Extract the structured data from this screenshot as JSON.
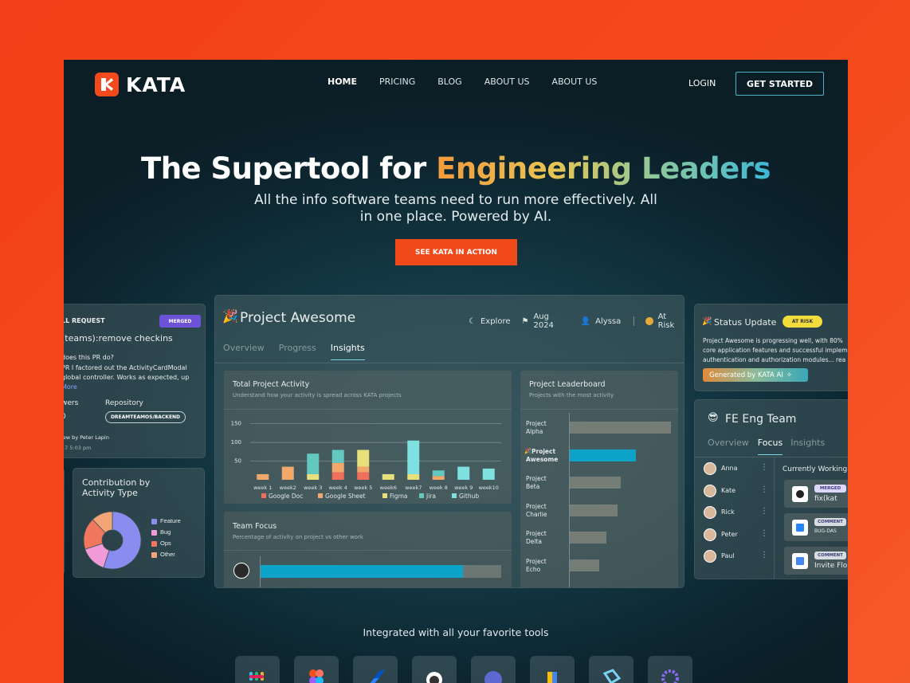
{
  "brand": {
    "name": "KATA"
  },
  "nav": {
    "links": [
      "HOME",
      "PRICING",
      "BLOG",
      "ABOUT US",
      "ABOUT US"
    ],
    "login": "LOGIN",
    "get_started": "GET STARTED"
  },
  "hero": {
    "title_prefix": "The Supertool for ",
    "title_highlight": "Engineering Leaders",
    "subtitle": "All the info software teams need to run more effectively. All in one place. Powered by AI.",
    "cta": "SEE KATA IN ACTION"
  },
  "pr_card": {
    "label": "LL REQUEST",
    "badge": "MERGED",
    "title": "(teams):remove checkins",
    "question": "does this PR do?",
    "body_line1": "PR I factored out the ActivityCardModal",
    "body_line2": "global controller. Works as expected, up",
    "more": "More",
    "reviewers_label": "wers",
    "reviewers_value": "0",
    "repo_label": "Repository",
    "repo_value": "DREAMTEAMOS/BACKEND",
    "review_by": "iew by Peter Lapin",
    "review_date": "17 5:03 pm"
  },
  "contribution": {
    "title": "Contribution by Activity Type",
    "legend": [
      "Feature",
      "Bug",
      "Ops",
      "Other"
    ],
    "colors": [
      "#8a8cf0",
      "#f09ad8",
      "#f1785d",
      "#f2a576"
    ],
    "values": [
      55,
      15,
      18,
      12
    ]
  },
  "project": {
    "emoji": "🎉",
    "title": "Project Awesome",
    "meta": {
      "explore": "Explore",
      "date": "Aug 2024",
      "owner": "Alyssa",
      "status": "At Risk"
    },
    "tabs": [
      "Overview",
      "Progress",
      "Insights"
    ],
    "active_tab": "Insights",
    "activity": {
      "title": "Total Project Activity",
      "subtitle": "Understand how your activity is spread across KATA projects"
    },
    "leaderboard": {
      "title": "Project Leaderboard",
      "subtitle": "Projects with the most activity",
      "items": [
        {
          "name_l1": "Project",
          "name_l2": "Alpha",
          "value": 100,
          "highlight": false
        },
        {
          "name_l1": "Project",
          "name_l2": "Awesome",
          "value": 65,
          "highlight": true,
          "emoji": "🎉"
        },
        {
          "name_l1": "Project",
          "name_l2": "Beta",
          "value": 50,
          "highlight": false
        },
        {
          "name_l1": "Project",
          "name_l2": "Charlie",
          "value": 47,
          "highlight": false
        },
        {
          "name_l1": "Project",
          "name_l2": "Delta",
          "value": 36,
          "highlight": false
        },
        {
          "name_l1": "Project",
          "name_l2": "Echo",
          "value": 29,
          "highlight": false
        }
      ]
    },
    "team_focus": {
      "title": "Team Focus",
      "subtitle": "Percentage of activity on project vs other work",
      "percent": 84
    }
  },
  "chart_data": {
    "type": "bar",
    "categories": [
      "week 1",
      "week2",
      "week 3",
      "week 4",
      "week 5",
      "week6",
      "week7",
      "week 8",
      "week 9",
      "week10"
    ],
    "series": [
      {
        "name": "Google Doc",
        "values": [
          0,
          0,
          0,
          20,
          20,
          0,
          0,
          0,
          0,
          0
        ]
      },
      {
        "name": "Google Sheet",
        "values": [
          15,
          35,
          0,
          25,
          15,
          0,
          0,
          10,
          0,
          0
        ]
      },
      {
        "name": "Figma",
        "values": [
          0,
          0,
          15,
          0,
          45,
          15,
          15,
          0,
          0,
          0
        ]
      },
      {
        "name": "Jira",
        "values": [
          0,
          0,
          55,
          35,
          0,
          0,
          0,
          15,
          0,
          0
        ]
      },
      {
        "name": "Github",
        "values": [
          0,
          0,
          0,
          0,
          0,
          0,
          90,
          0,
          35,
          30
        ]
      }
    ],
    "colors": [
      "#ef6f5a",
      "#f2a86a",
      "#e8e07a",
      "#63c8c0",
      "#7fe0e0"
    ],
    "yticks": [
      50,
      100,
      150
    ],
    "ylim": [
      0,
      160
    ]
  },
  "status_update": {
    "emoji": "🎉",
    "title": "Status Update",
    "badge": "AT RISK",
    "line1": "Project Awesome is progressing well, with 80%",
    "line2": "core application features and successful implem",
    "line3": "authentication and authorization modules... rea",
    "ai_tag": "Generated by KATA AI"
  },
  "fe_team": {
    "emoji": "😎",
    "title": "FE Eng Team",
    "tabs": [
      "Overview",
      "Focus",
      "Insights"
    ],
    "active_tab": "Focus",
    "members": [
      "Anna",
      "Kate",
      "Rick",
      "Peter",
      "Paul"
    ],
    "currently_working": "Currently Working",
    "items": [
      {
        "badge": "MERGED",
        "text": "fix(kat"
      },
      {
        "badge": "COMMENT",
        "text": "BUG-DAS"
      },
      {
        "badge": "COMMENT",
        "text": "Invite Flo"
      }
    ]
  },
  "integrations": {
    "title": "Integrated with all your favorite tools"
  }
}
